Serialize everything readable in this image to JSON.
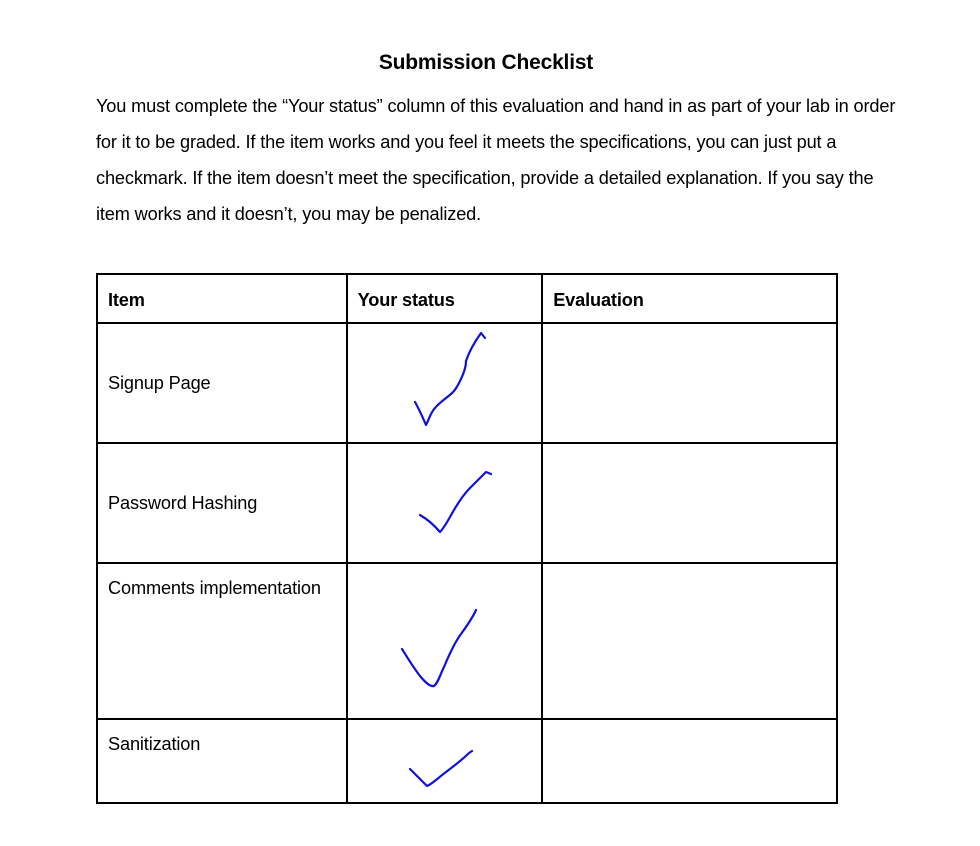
{
  "document": {
    "title": "Submission Checklist",
    "intro": "You must complete the “Your status” column of this evaluation and hand in as part of your lab in order for it to be graded. If the item works and you feel it meets the specifications, you can just put a checkmark. If the item doesn’t meet the specification, provide a detailed explanation. If you say the item works and it doesn’t, you may be penalized."
  },
  "table": {
    "headers": {
      "item": "Item",
      "status": "Your status",
      "evaluation": "Evaluation"
    },
    "rows": [
      {
        "item": "Signup Page",
        "status": "checkmark",
        "evaluation": ""
      },
      {
        "item": "Password Hashing",
        "status": "checkmark",
        "evaluation": ""
      },
      {
        "item": "Comments implementation",
        "status": "checkmark",
        "evaluation": ""
      },
      {
        "item": "Sanitization",
        "status": "checkmark",
        "evaluation": ""
      }
    ]
  },
  "colors": {
    "checkmark_ink": "#1010e0"
  },
  "icons": {
    "status_mark": "handwritten-checkmark-icon"
  }
}
